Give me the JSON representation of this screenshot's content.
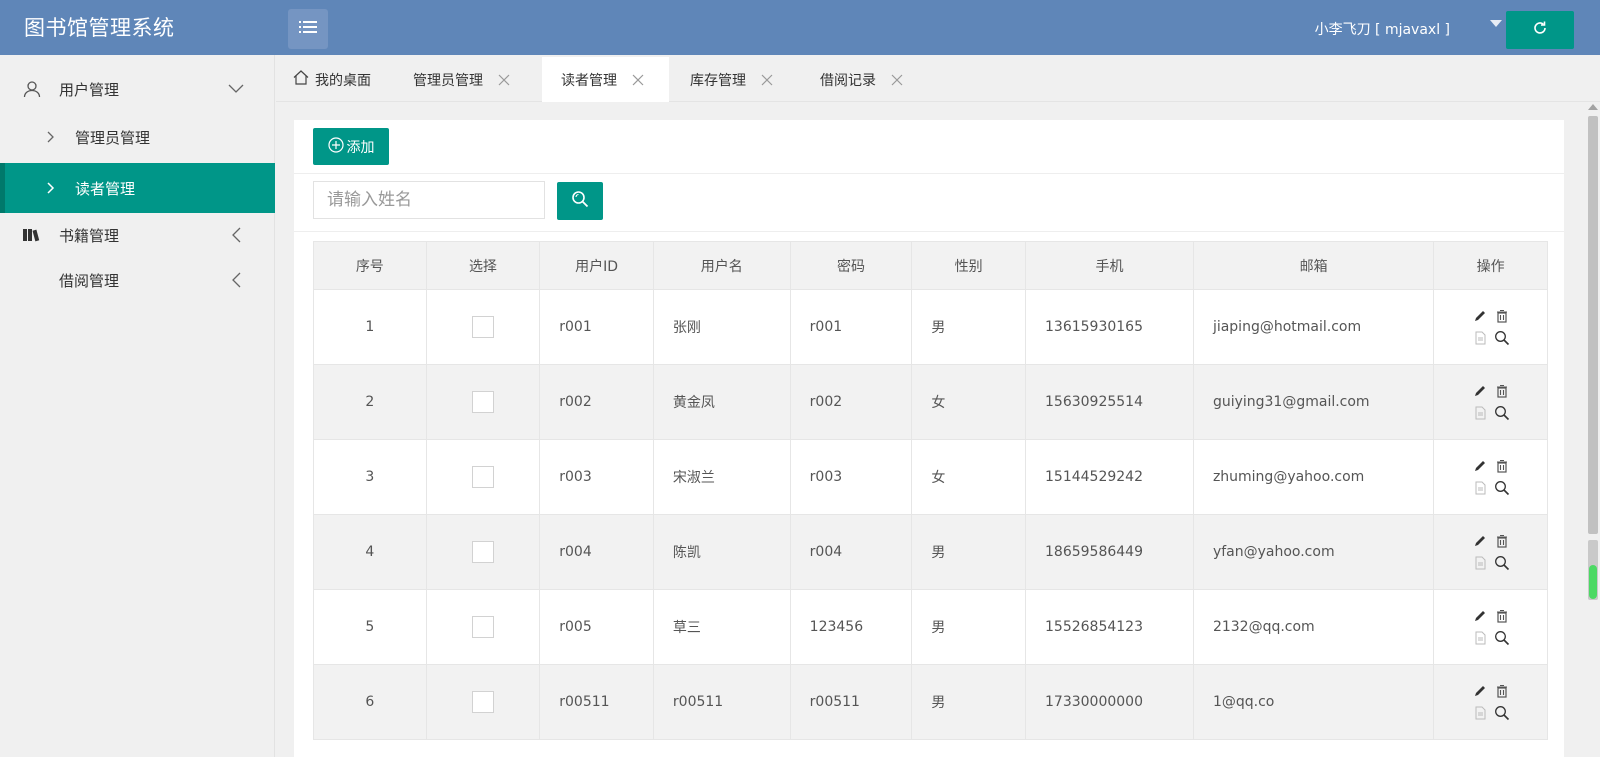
{
  "app": {
    "title": "图书馆管理系统"
  },
  "header": {
    "user_label": "小李飞刀 [ mjavaxl ]"
  },
  "sidebar": {
    "items": [
      {
        "label": "用户管理"
      },
      {
        "label": "管理员管理"
      },
      {
        "label": "读者管理"
      },
      {
        "label": "书籍管理"
      },
      {
        "label": "借阅管理"
      }
    ]
  },
  "tabs": [
    {
      "label": "我的桌面"
    },
    {
      "label": "管理员管理"
    },
    {
      "label": "读者管理"
    },
    {
      "label": "库存管理"
    },
    {
      "label": "借阅记录"
    }
  ],
  "toolbar": {
    "add_label": "添加"
  },
  "search": {
    "placeholder": "请输入姓名"
  },
  "table": {
    "headers": [
      "序号",
      "选择",
      "用户ID",
      "用户名",
      "密码",
      "性别",
      "手机",
      "邮箱",
      "操作"
    ],
    "rows": [
      {
        "no": "1",
        "id": "r001",
        "name": "张刚",
        "password": "r001",
        "gender": "男",
        "phone": "13615930165",
        "email": "jiaping@hotmail.com"
      },
      {
        "no": "2",
        "id": "r002",
        "name": "黄金凤",
        "password": "r002",
        "gender": "女",
        "phone": "15630925514",
        "email": "guiying31@gmail.com"
      },
      {
        "no": "3",
        "id": "r003",
        "name": "宋淑兰",
        "password": "r003",
        "gender": "女",
        "phone": "15144529242",
        "email": "zhuming@yahoo.com"
      },
      {
        "no": "4",
        "id": "r004",
        "name": "陈凯",
        "password": "r004",
        "gender": "男",
        "phone": "18659586449",
        "email": "yfan@yahoo.com"
      },
      {
        "no": "5",
        "id": "r005",
        "name": "草三",
        "password": "123456",
        "gender": "男",
        "phone": "15526854123",
        "email": "2132@qq.com"
      },
      {
        "no": "6",
        "id": "r00511",
        "name": "r00511",
        "password": "r00511",
        "gender": "男",
        "phone": "17330000000",
        "email": "1@qq.co"
      }
    ]
  },
  "colors": {
    "header_bg": "#5f86b8",
    "accent": "#009688"
  }
}
